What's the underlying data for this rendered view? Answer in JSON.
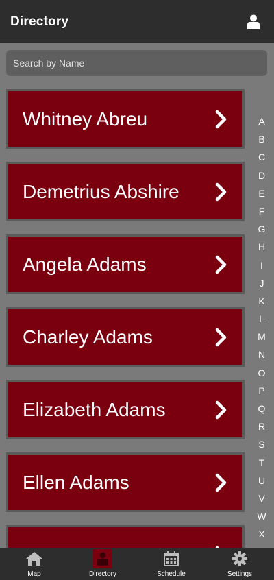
{
  "header": {
    "title": "Directory",
    "profile_icon": "person-icon"
  },
  "search": {
    "placeholder": "Search by Name",
    "value": ""
  },
  "entries": [
    {
      "name": "Whitney Abreu"
    },
    {
      "name": "Demetrius Abshire"
    },
    {
      "name": "Angela Adams"
    },
    {
      "name": "Charley Adams"
    },
    {
      "name": "Elizabeth Adams"
    },
    {
      "name": "Ellen Adams"
    },
    {
      "name": ""
    }
  ],
  "alphabet": [
    "A",
    "B",
    "C",
    "D",
    "E",
    "F",
    "G",
    "H",
    "I",
    "J",
    "K",
    "L",
    "M",
    "N",
    "O",
    "P",
    "Q",
    "R",
    "S",
    "T",
    "U",
    "V",
    "W",
    "X"
  ],
  "tabs": [
    {
      "label": "Map",
      "icon": "home-icon",
      "active": false
    },
    {
      "label": "Directory",
      "icon": "person-icon",
      "active": true
    },
    {
      "label": "Schedule",
      "icon": "calendar-icon",
      "active": false
    },
    {
      "label": "Settings",
      "icon": "gear-icon",
      "active": false
    }
  ],
  "colors": {
    "header": "#2d2d2d",
    "background": "#7a7a7a",
    "accent": "#7a0010",
    "search": "#5f5f5f"
  }
}
